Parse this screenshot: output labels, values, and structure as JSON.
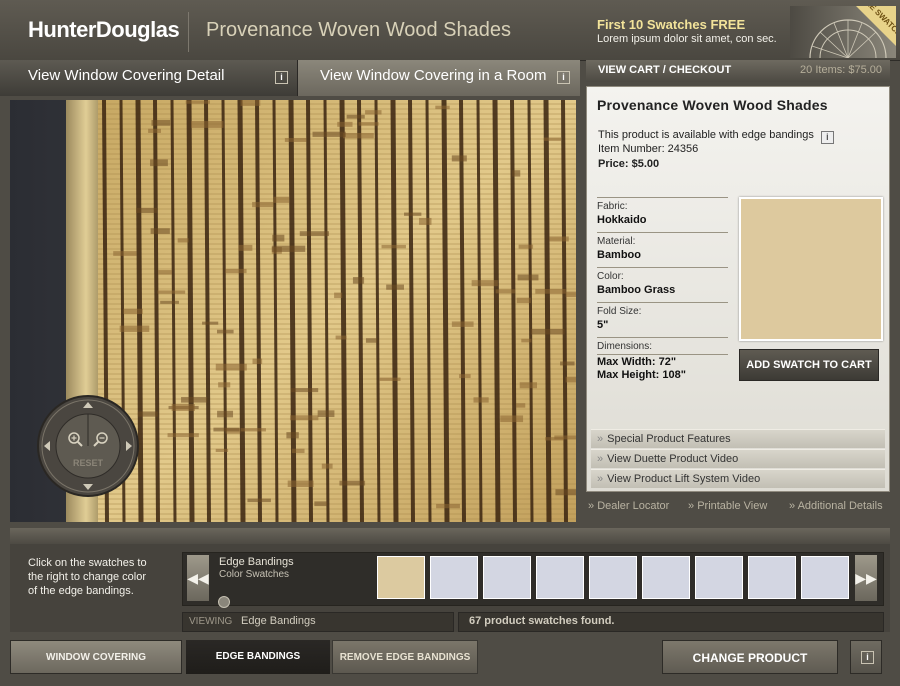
{
  "header": {
    "logo": "HunterDouglas",
    "product_title": "Provenance Woven Wood Shades",
    "promo_title": "First 10 Swatches FREE",
    "promo_subtitle": "Lorem ipsum dolor sit amet, con sec.",
    "promo_badge": "FREE SWATCHES"
  },
  "tabs": [
    {
      "label": "View Window Covering Detail",
      "icon": "info-icon"
    },
    {
      "label": "View Window Covering in a Room",
      "icon": "info-icon"
    }
  ],
  "viewer": {
    "reset_label": "RESET",
    "zoom_in_icon": "zoom-in-icon",
    "zoom_out_icon": "zoom-out-icon"
  },
  "cart": {
    "label": "VIEW CART / CHECKOUT",
    "summary": "20 Items: $75.00"
  },
  "detail": {
    "title": "Provenance Woven Wood Shades",
    "availability": "This product is available with edge bandings",
    "item_number": "Item Number:  24356",
    "price": "Price: $5.00",
    "fields": [
      {
        "label": "Fabric:",
        "value": "Hokkaido"
      },
      {
        "label": "Material:",
        "value": "Bamboo"
      },
      {
        "label": "Color:",
        "value": "Bamboo Grass"
      },
      {
        "label": "Fold Size:",
        "value": "5\""
      },
      {
        "label": "Dimensions:",
        "value": "Max Width: 72\"",
        "value2": "Max Height: 108\""
      }
    ],
    "swatch_color": "#ddc99e",
    "add_swatch_label": "ADD SWATCH TO CART",
    "feature_links": [
      "Special Product Features",
      "View Duette Product Video",
      "View Product Lift System Video"
    ]
  },
  "footer_links": [
    "Dealer Locator",
    "Printable View",
    "Additional Details"
  ],
  "swatches": {
    "hint": "Click on the swatches to the right to change color of the edge bandings.",
    "strip_label": "Edge Bandings",
    "strip_sublabel": "Color Swatches",
    "colors": [
      "#dccaa0",
      "#d3d6e2",
      "#d3d6e2",
      "#d3d6e2",
      "#d3d6e2",
      "#d3d6e2",
      "#d3d6e2",
      "#d3d6e2",
      "#d3d6e2"
    ],
    "viewing_label": "VIEWING",
    "viewing_value": "Edge Bandings",
    "count_text": "67 product swatches found."
  },
  "bottom_buttons": {
    "window_covering": "WINDOW COVERING",
    "edge_bandings": "EDGE BANDINGS",
    "remove_edge": "REMOVE  EDGE BANDINGS",
    "change_product": "CHANGE PRODUCT"
  }
}
